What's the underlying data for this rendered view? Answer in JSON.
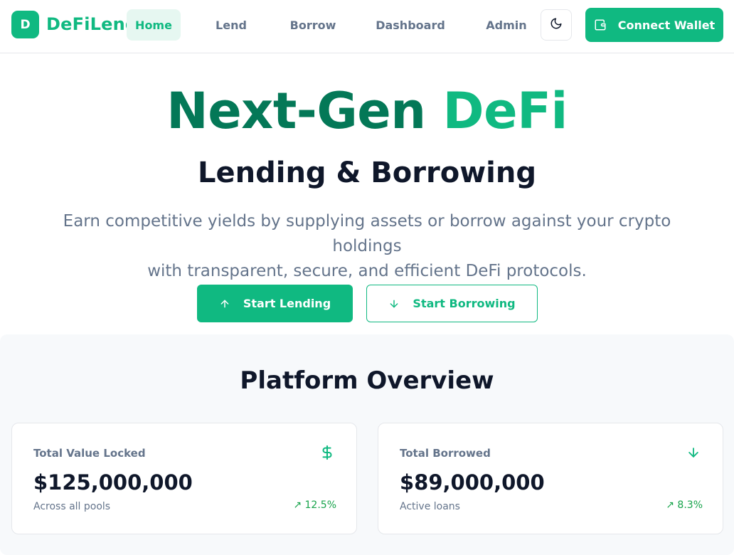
{
  "nav": {
    "logo_letter": "D",
    "brand": "DeFiLend",
    "links": [
      {
        "label": "Home"
      },
      {
        "label": "Lend"
      },
      {
        "label": "Borrow"
      },
      {
        "label": "Dashboard"
      },
      {
        "label": "Admin"
      }
    ],
    "theme_icon": "moon-icon",
    "wallet_icon": "wallet-icon",
    "wallet_label": "Connect Wallet"
  },
  "hero": {
    "title_part1": "Next-Gen",
    "title_part2": "DeFi",
    "subtitle": "Lending & Borrowing",
    "desc_line1": "Earn competitive yields by supplying assets or borrow against your crypto holdings",
    "desc_line2": "with transparent, secure, and efficient DeFi protocols.",
    "primary_label": "Start Lending",
    "secondary_label": "Start Borrowing"
  },
  "overview": {
    "title": "Platform Overview",
    "cards": [
      {
        "label": "Total Value Locked",
        "value": "$125,000,000",
        "note": "Across all pools",
        "change": "↗ 12.5%",
        "icon": "dollar-icon"
      },
      {
        "label": "Total Borrowed",
        "value": "$89,000,000",
        "note": "Active loans",
        "change": "↗ 8.3%",
        "icon": "arrow-down-icon"
      }
    ]
  },
  "colors": {
    "accent": "#10b981",
    "accent_dark": "#047857",
    "text_muted": "#64748b",
    "positive": "#16a34a"
  }
}
